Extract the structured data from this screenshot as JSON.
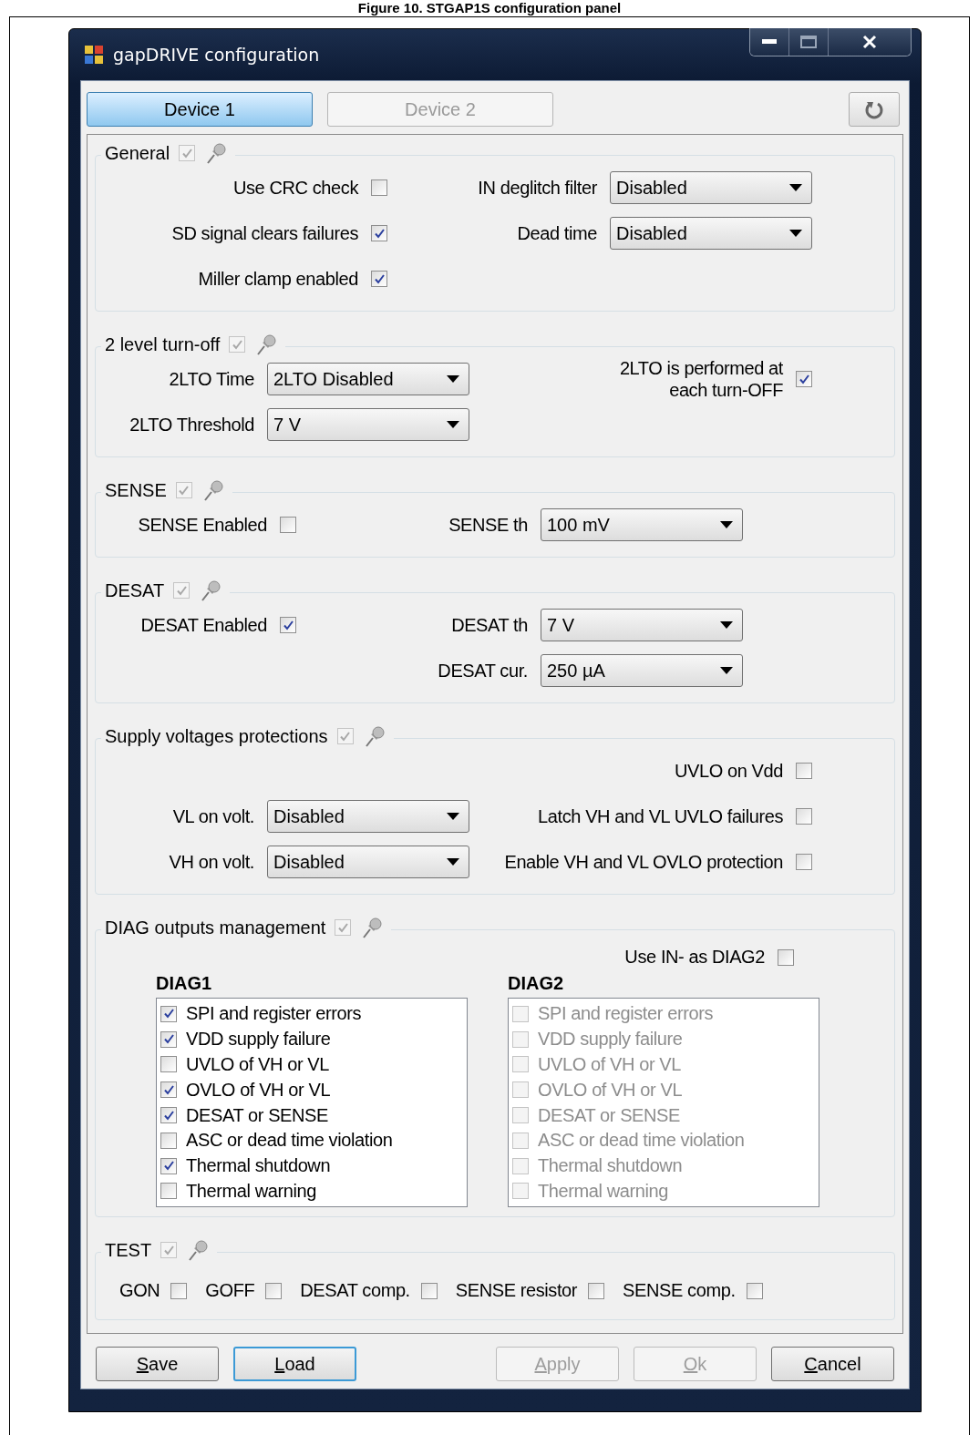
{
  "caption": "Figure 10. STGAP1S configuration panel",
  "window": {
    "title": "gapDRIVE configuration"
  },
  "device_tabs": [
    {
      "label": "Device 1",
      "selected": true
    },
    {
      "label": "Device 2",
      "selected": false
    }
  ],
  "sections": [
    {
      "kind": "grid",
      "title": "General",
      "checked": true,
      "disabled": true,
      "rows": [
        {
          "left": {
            "kind": "checkbox",
            "label": "Use CRC check",
            "checked": false
          },
          "right": {
            "kind": "dropdown",
            "label": "IN deglitch filter",
            "value": "Disabled"
          }
        },
        {
          "left": {
            "kind": "checkbox",
            "label": "SD signal clears failures",
            "checked": true
          },
          "right": {
            "kind": "dropdown",
            "label": "Dead time",
            "value": "Disabled"
          }
        },
        {
          "left": {
            "kind": "checkbox",
            "label": "Miller clamp enabled",
            "checked": true
          }
        }
      ]
    },
    {
      "kind": "grid",
      "title": "2 level turn-off",
      "checked": true,
      "disabled": true,
      "rows": [
        {
          "left": {
            "kind": "dropdown",
            "label": "2LTO Time",
            "value": "2LTO Disabled"
          },
          "right": {
            "kind": "checkbox",
            "label": "2LTO is performed at\neach turn-OFF",
            "checked": true
          }
        },
        {
          "left": {
            "kind": "dropdown",
            "label": "2LTO Threshold",
            "value": "7 V"
          }
        }
      ]
    },
    {
      "kind": "narrow",
      "title": "SENSE",
      "checked": true,
      "disabled": true,
      "rows": [
        {
          "left": {
            "kind": "checkbox",
            "label": "SENSE Enabled",
            "checked": false
          },
          "right": {
            "kind": "dropdown",
            "label": "SENSE th",
            "value": "100 mV"
          }
        }
      ]
    },
    {
      "kind": "narrow",
      "title": "DESAT",
      "checked": true,
      "disabled": true,
      "rows": [
        {
          "left": {
            "kind": "checkbox",
            "label": "DESAT Enabled",
            "checked": true
          },
          "right": {
            "kind": "dropdown",
            "label": "DESAT th",
            "value": "7 V"
          }
        },
        {
          "right": {
            "kind": "dropdown",
            "label": "DESAT cur.",
            "value": "250 µA"
          }
        }
      ]
    },
    {
      "kind": "grid",
      "title": "Supply voltages protections",
      "checked": true,
      "disabled": true,
      "rows": [
        {
          "right": {
            "kind": "checkbox",
            "label": "UVLO on Vdd",
            "checked": false
          }
        },
        {
          "left": {
            "kind": "dropdown",
            "label": "VL on volt.",
            "value": "Disabled"
          },
          "right": {
            "kind": "checkbox",
            "label": "Latch VH and VL UVLO failures",
            "checked": false
          }
        },
        {
          "left": {
            "kind": "dropdown",
            "label": "VH on volt.",
            "value": "Disabled"
          },
          "right": {
            "kind": "checkbox",
            "label": "Enable VH and VL OVLO protection",
            "checked": false
          }
        }
      ]
    },
    {
      "kind": "diag",
      "title": "DIAG outputs management",
      "checked": true,
      "disabled": true,
      "option": {
        "label": "Use IN- as DIAG2",
        "checked": false
      },
      "lists": [
        {
          "title": "DIAG1",
          "disabled": false,
          "items": [
            {
              "label": "SPI and register errors",
              "checked": true
            },
            {
              "label": "VDD supply failure",
              "checked": true
            },
            {
              "label": "UVLO of VH or VL",
              "checked": false
            },
            {
              "label": "OVLO of VH or VL",
              "checked": true
            },
            {
              "label": "DESAT or SENSE",
              "checked": true
            },
            {
              "label": "ASC or dead time violation",
              "checked": false
            },
            {
              "label": "Thermal shutdown",
              "checked": true
            },
            {
              "label": "Thermal warning",
              "checked": false
            }
          ]
        },
        {
          "title": "DIAG2",
          "disabled": true,
          "items": [
            {
              "label": "SPI and register errors",
              "checked": false
            },
            {
              "label": "VDD supply failure",
              "checked": false
            },
            {
              "label": "UVLO of VH or VL",
              "checked": false
            },
            {
              "label": "OVLO of VH or VL",
              "checked": false
            },
            {
              "label": "DESAT or SENSE",
              "checked": false
            },
            {
              "label": "ASC or dead time violation",
              "checked": false
            },
            {
              "label": "Thermal shutdown",
              "checked": false
            },
            {
              "label": "Thermal warning",
              "checked": false
            }
          ]
        }
      ]
    },
    {
      "kind": "inline",
      "title": "TEST",
      "checked": true,
      "disabled": true,
      "items": [
        {
          "label": "GON",
          "checked": false
        },
        {
          "label": "GOFF",
          "checked": false
        },
        {
          "label": "DESAT comp.",
          "checked": false
        },
        {
          "label": "SENSE resistor",
          "checked": false
        },
        {
          "label": "SENSE comp.",
          "checked": false
        }
      ]
    }
  ],
  "buttons": [
    {
      "label": "Save",
      "disabled": false,
      "default": false
    },
    {
      "label": "Load",
      "disabled": false,
      "default": true
    },
    {
      "label": "Apply",
      "disabled": true,
      "default": false
    },
    {
      "label": "Ok",
      "disabled": true,
      "default": false
    },
    {
      "label": "Cancel",
      "disabled": false,
      "default": false
    }
  ]
}
